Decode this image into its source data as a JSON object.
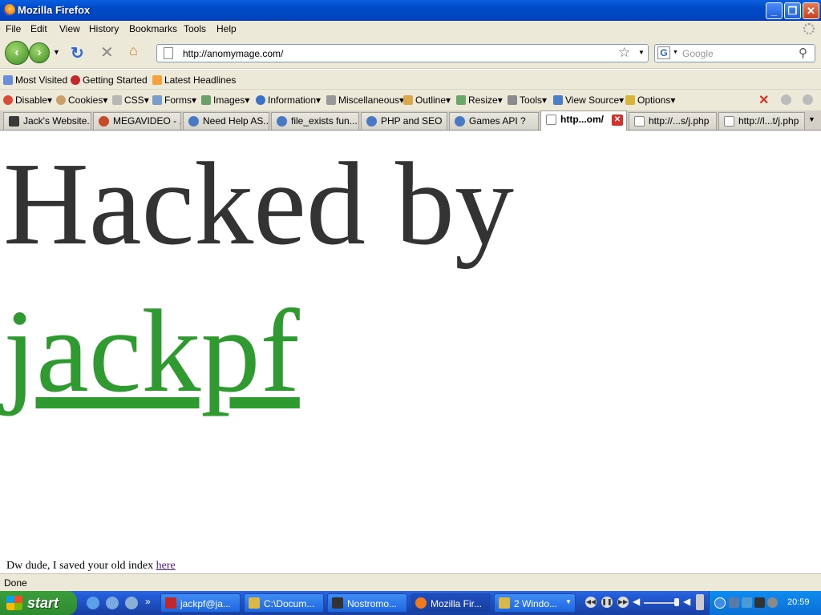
{
  "window": {
    "title": "Mozilla Firefox"
  },
  "menu": [
    "File",
    "Edit",
    "View",
    "History",
    "Bookmarks",
    "Tools",
    "Help"
  ],
  "navigation": {
    "url": "http://anomymage.com/",
    "search_placeholder": "Google"
  },
  "bookmarks": [
    "Most Visited",
    "Getting Started",
    "Latest Headlines"
  ],
  "dev_toolbar": [
    "Disable",
    "Cookies",
    "CSS",
    "Forms",
    "Images",
    "Information",
    "Miscellaneous",
    "Outline",
    "Resize",
    "Tools",
    "View Source",
    "Options"
  ],
  "tabs": [
    {
      "label": "Jack's Website..."
    },
    {
      "label": "MEGAVIDEO - ..."
    },
    {
      "label": "Need Help AS..."
    },
    {
      "label": "file_exists fun..."
    },
    {
      "label": "PHP and SEO"
    },
    {
      "label": "Games API ?"
    },
    {
      "label": "http...om/",
      "active": true
    },
    {
      "label": "http://...s/j.php"
    },
    {
      "label": "http://l...t/j.php"
    }
  ],
  "page": {
    "heading": "Hacked by",
    "handle": "jackpf",
    "footnote_text": "Dw dude, I saved your old index",
    "footnote_link": "here"
  },
  "status": "Done",
  "taskbar": {
    "start": "start",
    "tasks": [
      {
        "label": "jackpf@ja..."
      },
      {
        "label": "C:\\Docum..."
      },
      {
        "label": "Nostromo..."
      },
      {
        "label": "Mozilla Fir...",
        "active": true
      },
      {
        "label": "2 Windo..."
      }
    ],
    "clock": "20:59"
  },
  "colors": {
    "handle": "#2f9a2f",
    "heading": "#333333",
    "title_bar": "#0a5fe0",
    "taskbar": "#245edb"
  }
}
